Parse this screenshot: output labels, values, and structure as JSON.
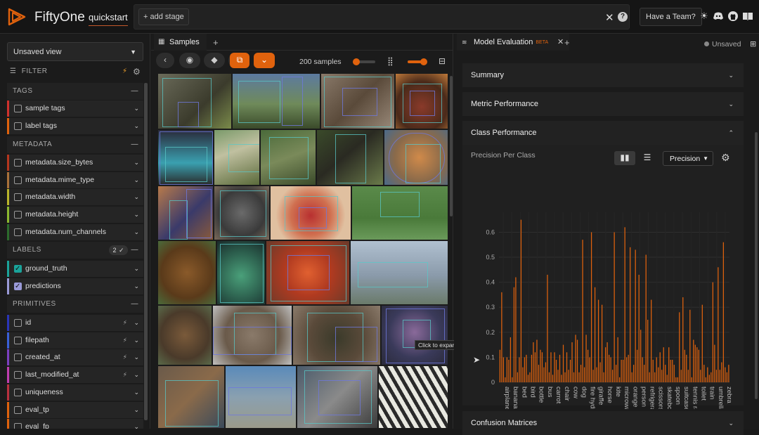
{
  "header": {
    "brand": "FiftyOne",
    "dataset": "quickstart",
    "add_stage": "+ add stage",
    "team_button": "Have a Team?",
    "icons": [
      "close-icon",
      "help-icon",
      "sun-icon",
      "discord-icon",
      "github-icon",
      "book-icon"
    ]
  },
  "sidebar": {
    "view_select": "Unsaved view",
    "filter_label": "FILTER",
    "sections": {
      "tags": "TAGS",
      "metadata": "METADATA",
      "labels": "LABELS",
      "labels_badge": "2 ✓",
      "primitives": "PRIMITIVES"
    },
    "tags": [
      "sample tags",
      "label tags"
    ],
    "metadata": [
      "metadata.size_bytes",
      "metadata.mime_type",
      "metadata.width",
      "metadata.height",
      "metadata.num_channels"
    ],
    "labels": [
      "ground_truth",
      "predictions"
    ],
    "primitives": [
      "id",
      "filepath",
      "created_at",
      "last_modified_at",
      "uniqueness",
      "eval_tp",
      "eval_fp"
    ],
    "colors": {
      "tags": [
        "#d0312d",
        "#e0620d"
      ],
      "metadata": [
        "#b5361e",
        "#a9713a",
        "#b9b52b",
        "#8cb82f",
        "#2c6b2c"
      ],
      "labels": [
        "#1aa39a",
        "#9a9ad8"
      ],
      "primitives": [
        "#2a35b8",
        "#3a5fd8",
        "#7b3fc0",
        "#c03db0",
        "#b8303e",
        "#e0620d",
        "#e0620d"
      ]
    }
  },
  "samples": {
    "tab_label": "Samples",
    "count": "200 samples",
    "tooltip": "Click to expand"
  },
  "panel": {
    "tab_label": "Model Evaluation",
    "beta": "BETA",
    "unsaved": "Unsaved",
    "sections": {
      "summary": "Summary",
      "metric_performance": "Metric Performance",
      "class_performance": "Class Performance",
      "confusion_matrices": "Confusion Matrices"
    },
    "chart_title": "Precision Per Class",
    "metric_select": "Precision"
  },
  "chart_data": {
    "type": "bar",
    "title": "Precision Per Class",
    "ylim": [
      0,
      0.68
    ],
    "yticks": [
      0,
      0.1,
      0.2,
      0.3,
      0.4,
      0.5,
      0.6
    ],
    "ytick_labels": [
      "0",
      "0.1",
      "0.2",
      "0.3",
      "0.4",
      "0.5",
      "0.6"
    ],
    "xtick_labels": [
      "airplane",
      "banana",
      "bed",
      "bird",
      "bottle",
      "bus",
      "carrot",
      "chair",
      "cow",
      "dog",
      "fire hydrant",
      "giraffe",
      "horse",
      "kite",
      "microwave",
      "orange",
      "person",
      "refrigerator",
      "scissors",
      "skateboard",
      "spoon",
      "suitcase",
      "tennis racket",
      "toilet",
      "train",
      "umbrella",
      "zebra"
    ],
    "color": "#e0620d",
    "grid": true,
    "values": [
      0.13,
      0.36,
      0.1,
      0.02,
      0.1,
      0.09,
      0.18,
      0.02,
      0.38,
      0.42,
      0.04,
      0.1,
      0.65,
      0.06,
      0.1,
      0.11,
      0.03,
      0.04,
      0.11,
      0.16,
      0.12,
      0.17,
      0.07,
      0.13,
      0.12,
      0.06,
      0.08,
      0.43,
      0.04,
      0.12,
      0.03,
      0.12,
      0.09,
      0.05,
      0.11,
      0.03,
      0.15,
      0.04,
      0.12,
      0.05,
      0.09,
      0.16,
      0.04,
      0.19,
      0.17,
      0.04,
      0.07,
      0.57,
      0.06,
      0.19,
      0.13,
      0.1,
      0.6,
      0.05,
      0.38,
      0.06,
      0.33,
      0.08,
      0.31,
      0.04,
      0.14,
      0.16,
      0.11,
      0.1,
      0.05,
      0.6,
      0.07,
      0.18,
      0.02,
      0.09,
      0.09,
      0.62,
      0.1,
      0.11,
      0.54,
      0.04,
      0.07,
      0.53,
      0.13,
      0.43,
      0.21,
      0.1,
      0.07,
      0.51,
      0.25,
      0.04,
      0.33,
      0.09,
      0.04,
      0.1,
      0.06,
      0.12,
      0.05,
      0.14,
      0.07,
      0.03,
      0.14,
      0.09,
      0.09,
      0.07,
      0.02,
      0.02,
      0.28,
      0.05,
      0.34,
      0.13,
      0.11,
      0.05,
      0.29,
      0.02,
      0.17,
      0.15,
      0.14,
      0.13,
      0.05,
      0.31,
      0.07,
      0.02,
      0.06,
      0.03,
      0.04,
      0.4,
      0.15,
      0.05,
      0.46,
      0.05,
      0.08,
      0.56,
      0.06,
      0.04,
      0.07
    ]
  }
}
